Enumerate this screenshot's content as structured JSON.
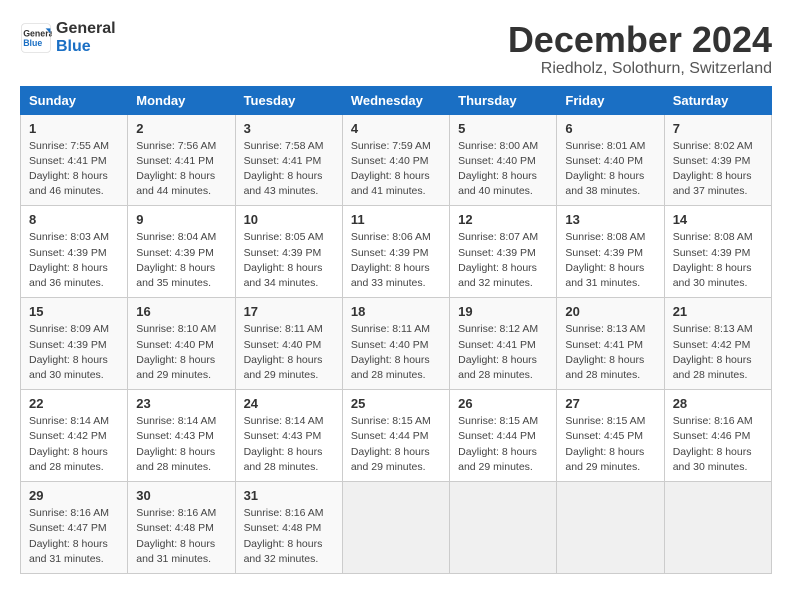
{
  "logo": {
    "line1": "General",
    "line2": "Blue"
  },
  "title": "December 2024",
  "location": "Riedholz, Solothurn, Switzerland",
  "weekdays": [
    "Sunday",
    "Monday",
    "Tuesday",
    "Wednesday",
    "Thursday",
    "Friday",
    "Saturday"
  ],
  "weeks": [
    [
      {
        "day": "1",
        "rise": "Sunrise: 7:55 AM",
        "set": "Sunset: 4:41 PM",
        "daylight": "Daylight: 8 hours and 46 minutes."
      },
      {
        "day": "2",
        "rise": "Sunrise: 7:56 AM",
        "set": "Sunset: 4:41 PM",
        "daylight": "Daylight: 8 hours and 44 minutes."
      },
      {
        "day": "3",
        "rise": "Sunrise: 7:58 AM",
        "set": "Sunset: 4:41 PM",
        "daylight": "Daylight: 8 hours and 43 minutes."
      },
      {
        "day": "4",
        "rise": "Sunrise: 7:59 AM",
        "set": "Sunset: 4:40 PM",
        "daylight": "Daylight: 8 hours and 41 minutes."
      },
      {
        "day": "5",
        "rise": "Sunrise: 8:00 AM",
        "set": "Sunset: 4:40 PM",
        "daylight": "Daylight: 8 hours and 40 minutes."
      },
      {
        "day": "6",
        "rise": "Sunrise: 8:01 AM",
        "set": "Sunset: 4:40 PM",
        "daylight": "Daylight: 8 hours and 38 minutes."
      },
      {
        "day": "7",
        "rise": "Sunrise: 8:02 AM",
        "set": "Sunset: 4:39 PM",
        "daylight": "Daylight: 8 hours and 37 minutes."
      }
    ],
    [
      {
        "day": "8",
        "rise": "Sunrise: 8:03 AM",
        "set": "Sunset: 4:39 PM",
        "daylight": "Daylight: 8 hours and 36 minutes."
      },
      {
        "day": "9",
        "rise": "Sunrise: 8:04 AM",
        "set": "Sunset: 4:39 PM",
        "daylight": "Daylight: 8 hours and 35 minutes."
      },
      {
        "day": "10",
        "rise": "Sunrise: 8:05 AM",
        "set": "Sunset: 4:39 PM",
        "daylight": "Daylight: 8 hours and 34 minutes."
      },
      {
        "day": "11",
        "rise": "Sunrise: 8:06 AM",
        "set": "Sunset: 4:39 PM",
        "daylight": "Daylight: 8 hours and 33 minutes."
      },
      {
        "day": "12",
        "rise": "Sunrise: 8:07 AM",
        "set": "Sunset: 4:39 PM",
        "daylight": "Daylight: 8 hours and 32 minutes."
      },
      {
        "day": "13",
        "rise": "Sunrise: 8:08 AM",
        "set": "Sunset: 4:39 PM",
        "daylight": "Daylight: 8 hours and 31 minutes."
      },
      {
        "day": "14",
        "rise": "Sunrise: 8:08 AM",
        "set": "Sunset: 4:39 PM",
        "daylight": "Daylight: 8 hours and 30 minutes."
      }
    ],
    [
      {
        "day": "15",
        "rise": "Sunrise: 8:09 AM",
        "set": "Sunset: 4:39 PM",
        "daylight": "Daylight: 8 hours and 30 minutes."
      },
      {
        "day": "16",
        "rise": "Sunrise: 8:10 AM",
        "set": "Sunset: 4:40 PM",
        "daylight": "Daylight: 8 hours and 29 minutes."
      },
      {
        "day": "17",
        "rise": "Sunrise: 8:11 AM",
        "set": "Sunset: 4:40 PM",
        "daylight": "Daylight: 8 hours and 29 minutes."
      },
      {
        "day": "18",
        "rise": "Sunrise: 8:11 AM",
        "set": "Sunset: 4:40 PM",
        "daylight": "Daylight: 8 hours and 28 minutes."
      },
      {
        "day": "19",
        "rise": "Sunrise: 8:12 AM",
        "set": "Sunset: 4:41 PM",
        "daylight": "Daylight: 8 hours and 28 minutes."
      },
      {
        "day": "20",
        "rise": "Sunrise: 8:13 AM",
        "set": "Sunset: 4:41 PM",
        "daylight": "Daylight: 8 hours and 28 minutes."
      },
      {
        "day": "21",
        "rise": "Sunrise: 8:13 AM",
        "set": "Sunset: 4:42 PM",
        "daylight": "Daylight: 8 hours and 28 minutes."
      }
    ],
    [
      {
        "day": "22",
        "rise": "Sunrise: 8:14 AM",
        "set": "Sunset: 4:42 PM",
        "daylight": "Daylight: 8 hours and 28 minutes."
      },
      {
        "day": "23",
        "rise": "Sunrise: 8:14 AM",
        "set": "Sunset: 4:43 PM",
        "daylight": "Daylight: 8 hours and 28 minutes."
      },
      {
        "day": "24",
        "rise": "Sunrise: 8:14 AM",
        "set": "Sunset: 4:43 PM",
        "daylight": "Daylight: 8 hours and 28 minutes."
      },
      {
        "day": "25",
        "rise": "Sunrise: 8:15 AM",
        "set": "Sunset: 4:44 PM",
        "daylight": "Daylight: 8 hours and 29 minutes."
      },
      {
        "day": "26",
        "rise": "Sunrise: 8:15 AM",
        "set": "Sunset: 4:44 PM",
        "daylight": "Daylight: 8 hours and 29 minutes."
      },
      {
        "day": "27",
        "rise": "Sunrise: 8:15 AM",
        "set": "Sunset: 4:45 PM",
        "daylight": "Daylight: 8 hours and 29 minutes."
      },
      {
        "day": "28",
        "rise": "Sunrise: 8:16 AM",
        "set": "Sunset: 4:46 PM",
        "daylight": "Daylight: 8 hours and 30 minutes."
      }
    ],
    [
      {
        "day": "29",
        "rise": "Sunrise: 8:16 AM",
        "set": "Sunset: 4:47 PM",
        "daylight": "Daylight: 8 hours and 31 minutes."
      },
      {
        "day": "30",
        "rise": "Sunrise: 8:16 AM",
        "set": "Sunset: 4:48 PM",
        "daylight": "Daylight: 8 hours and 31 minutes."
      },
      {
        "day": "31",
        "rise": "Sunrise: 8:16 AM",
        "set": "Sunset: 4:48 PM",
        "daylight": "Daylight: 8 hours and 32 minutes."
      },
      null,
      null,
      null,
      null
    ]
  ]
}
